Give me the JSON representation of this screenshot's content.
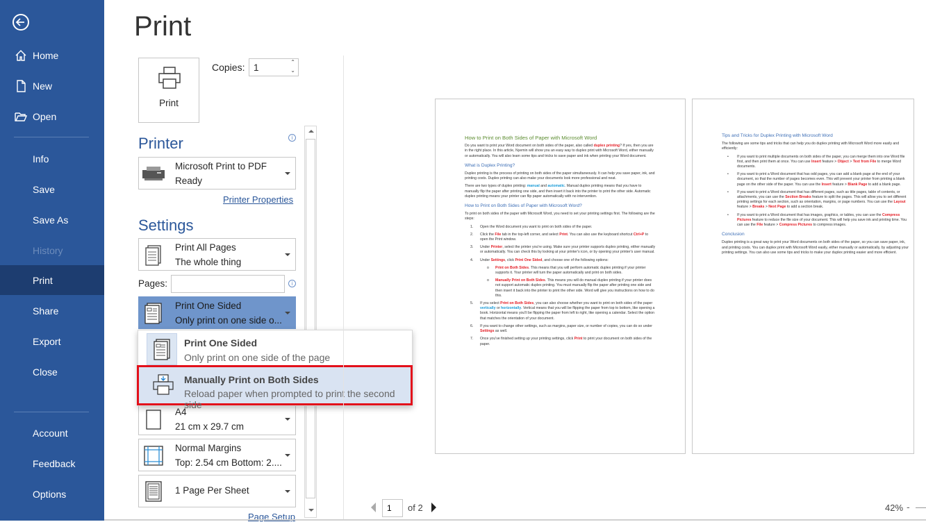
{
  "sidebar": {
    "back_label": "Back",
    "items": [
      {
        "label": "Home",
        "icon": "home-icon"
      },
      {
        "label": "New",
        "icon": "new-document-icon"
      },
      {
        "label": "Open",
        "icon": "folder-open-icon"
      },
      {
        "label": "Info"
      },
      {
        "label": "Save"
      },
      {
        "label": "Save As"
      },
      {
        "label": "History",
        "disabled": true
      },
      {
        "label": "Print",
        "selected": true
      },
      {
        "label": "Share"
      },
      {
        "label": "Export"
      },
      {
        "label": "Close"
      },
      {
        "label": "Account"
      },
      {
        "label": "Feedback"
      },
      {
        "label": "Options"
      }
    ],
    "color": "#2b579a"
  },
  "print": {
    "title": "Print",
    "print_button": "Print",
    "copies_label": "Copies:",
    "copies_value": "1",
    "printer_heading": "Printer",
    "printer": {
      "name": "Microsoft Print to PDF",
      "status": "Ready"
    },
    "printer_properties": "Printer Properties",
    "settings_heading": "Settings",
    "pages_range": {
      "title": "Print All Pages",
      "subtitle": "The whole thing"
    },
    "pages_label": "Pages:",
    "pages_value": "",
    "sides": {
      "title": "Print One Sided",
      "subtitle": "Only print on one side o..."
    },
    "sides_menu": [
      {
        "title": "Print One Sided",
        "subtitle": "Only print on one side of the page"
      },
      {
        "title": "Manually Print on Both Sides",
        "subtitle": "Reload paper when prompted to print the second side",
        "highlighted": true
      }
    ],
    "paper": {
      "title": "A4",
      "subtitle": "21 cm x 29.7 cm"
    },
    "margins": {
      "title": "Normal Margins",
      "subtitle": "Top: 2.54 cm Bottom: 2...."
    },
    "per_sheet": {
      "title": "1 Page Per Sheet"
    },
    "page_setup": "Page Setup",
    "info_icon": "i"
  },
  "preview": {
    "current_page": "1",
    "of_pages": "of 2",
    "zoom": "42%",
    "zoom_minus": "-"
  },
  "document": {
    "pages": [
      {
        "blocks": [
          {
            "type": "h1",
            "runs": [
              {
                "text": "How to Print on Both Sides of Paper with Microsoft Word"
              }
            ]
          },
          {
            "type": "p",
            "runs": [
              {
                "text": "Do you want to print your Word document on both sides of the paper, also called "
              },
              {
                "text": "duplex printing",
                "style": "red"
              },
              {
                "text": "? If yes, then you are in the right place. In this article, Nyemin will show you an easy way to duplex print with Microsoft Word, either manually or automatically. You will also learn some tips and tricks to save paper and ink when printing your Word document."
              }
            ]
          },
          {
            "type": "h2",
            "runs": [
              {
                "text": "What is Duplex Printing?"
              }
            ]
          },
          {
            "type": "p",
            "runs": [
              {
                "text": "Duplex printing is the process of printing on both sides of the paper simultaneously. It can help you save paper, ink, and printing costs. Duplex printing can also make your documents look more professional and neat."
              }
            ]
          },
          {
            "type": "p",
            "runs": [
              {
                "text": "There are two types of duplex printing: "
              },
              {
                "text": "manual",
                "style": "blue"
              },
              {
                "text": " and "
              },
              {
                "text": "automatic",
                "style": "blue"
              },
              {
                "text": ". Manual duplex printing means that you have to manually flip the paper after printing one side, and then insert it back into the printer to print the other side. Automatic duplex printing means your printer can flip paper automatically with no intervention."
              }
            ]
          },
          {
            "type": "h2",
            "runs": [
              {
                "text": "How to Print on Both Sides of Paper with Microsoft Word?"
              }
            ]
          },
          {
            "type": "p",
            "runs": [
              {
                "text": "To print on both sides of the paper with Microsoft Word, you need to set your printing settings first. The following are the steps:"
              }
            ]
          },
          {
            "type": "it",
            "marker": "1.",
            "runs": [
              {
                "text": "Open the Word document you want to print on both sides of the paper."
              }
            ]
          },
          {
            "type": "it",
            "marker": "2.",
            "runs": [
              {
                "text": "Click the "
              },
              {
                "text": "File",
                "style": "red"
              },
              {
                "text": " tab in the top-left corner, and select "
              },
              {
                "text": "Print",
                "style": "red"
              },
              {
                "text": ". You can also use the keyboard shortcut "
              },
              {
                "text": "Ctrl+P",
                "style": "red"
              },
              {
                "text": " to open the Print window."
              }
            ]
          },
          {
            "type": "it",
            "marker": "3.",
            "runs": [
              {
                "text": "Under "
              },
              {
                "text": "Printer",
                "style": "red"
              },
              {
                "text": ", select the printer you're using. Make sure your printer supports duplex printing, either manually or automatically. You can check this by looking at your printer's icon, or by opening your printer's user manual."
              }
            ]
          },
          {
            "type": "it",
            "marker": "4.",
            "runs": [
              {
                "text": "Under "
              },
              {
                "text": "Settings",
                "style": "red"
              },
              {
                "text": ", click "
              },
              {
                "text": "Print One Sided",
                "style": "red"
              },
              {
                "text": ", and choose one of the following options:"
              }
            ]
          },
          {
            "type": "sub",
            "marker": "o",
            "runs": [
              {
                "text": "Print on Both Sides",
                "style": "red"
              },
              {
                "text": ". This means that you will perform automatic duplex printing if your printer supports it. Your printer will turn the paper automatically and print on both sides."
              }
            ]
          },
          {
            "type": "sub",
            "marker": "o",
            "runs": [
              {
                "text": "Manually Print on Both Sides",
                "style": "red"
              },
              {
                "text": ". This means you will do manual duplex printing if your printer does not support automatic duplex printing. You must manually flip the paper after printing one side and then insert it back into the printer to print the other side. Word will give you instructions on how to do this."
              }
            ]
          },
          {
            "type": "it",
            "marker": "5.",
            "runs": [
              {
                "text": "If you select "
              },
              {
                "text": "Print on Both Sides",
                "style": "red"
              },
              {
                "text": ", you can also choose whether you want to print on both sides of the paper "
              },
              {
                "text": "vertically",
                "style": "blue"
              },
              {
                "text": " or "
              },
              {
                "text": "horizontally",
                "style": "blue"
              },
              {
                "text": ". Vertical means that you will be flipping the paper from top to bottom, like opening a book. Horizontal means you'll be flipping the paper from left to right, like opening a calendar. Select the option that matches the orientation of your document."
              }
            ]
          },
          {
            "type": "it",
            "marker": "6.",
            "runs": [
              {
                "text": "If you want to change other settings, such as margins, paper size, or number of copies, you can do so under "
              },
              {
                "text": "Settings",
                "style": "red"
              },
              {
                "text": " as well."
              }
            ]
          },
          {
            "type": "it",
            "marker": "7.",
            "runs": [
              {
                "text": "Once you've finished setting up your printing settings, click "
              },
              {
                "text": "Print",
                "style": "red"
              },
              {
                "text": " to print your document on both sides of the paper."
              }
            ]
          }
        ]
      },
      {
        "blocks": [
          {
            "type": "h2",
            "runs": [
              {
                "text": "Tips and Tricks for Duplex Printing with Microsoft Word"
              }
            ]
          },
          {
            "type": "p",
            "runs": [
              {
                "text": "The following are some tips and tricks that can help you do duplex printing with Microsoft Word more easily and efficiently:"
              }
            ]
          },
          {
            "type": "it",
            "marker": "•",
            "runs": [
              {
                "text": "If you want to print multiple documents on both sides of the paper, you can merge them into one Word file first, and then print them at once. You can use "
              },
              {
                "text": "Insert",
                "style": "red"
              },
              {
                "text": " feature > "
              },
              {
                "text": "Object",
                "style": "red"
              },
              {
                "text": " > "
              },
              {
                "text": "Text from File",
                "style": "red"
              },
              {
                "text": " to merge Word documents."
              }
            ]
          },
          {
            "type": "it",
            "marker": "•",
            "runs": [
              {
                "text": "If you want to print a Word document that has odd pages, you can add a blank page at the end of your document, so that the number of pages becomes even. This will prevent your printer from printing a blank page on the other side of the paper. You can use the "
              },
              {
                "text": "Insert",
                "style": "red"
              },
              {
                "text": " feature > "
              },
              {
                "text": "Blank Page",
                "style": "red"
              },
              {
                "text": " to add a blank page."
              }
            ]
          },
          {
            "type": "it",
            "marker": "•",
            "runs": [
              {
                "text": "If you want to print a Word document that has different pages, such as title pages, table of contents, or attachments, you can use the "
              },
              {
                "text": "Section Breaks",
                "style": "red"
              },
              {
                "text": " feature to split the pages. This will allow you to set different printing settings for each section, such as orientation, margins, or page numbers. You can use the "
              },
              {
                "text": "Layout",
                "style": "red"
              },
              {
                "text": " feature > "
              },
              {
                "text": "Breaks",
                "style": "red"
              },
              {
                "text": " > "
              },
              {
                "text": "Next Page",
                "style": "red"
              },
              {
                "text": " to add a section break."
              }
            ]
          },
          {
            "type": "it",
            "marker": "•",
            "runs": [
              {
                "text": "If you want to print a Word document that has images, graphics, or tables, you can use the "
              },
              {
                "text": "Compress Pictures",
                "style": "red"
              },
              {
                "text": " feature to reduce the file size of your document. This will help you save ink and printing time. You can use the "
              },
              {
                "text": "File",
                "style": "red"
              },
              {
                "text": " feature > "
              },
              {
                "text": "Compress Pictures",
                "style": "red"
              },
              {
                "text": " to compress images."
              }
            ]
          },
          {
            "type": "h2",
            "runs": [
              {
                "text": "Conclusion"
              }
            ]
          },
          {
            "type": "p",
            "runs": [
              {
                "text": "Duplex printing is a great way to print your Word documents on both sides of the paper, so you can save paper, ink, and printing costs. You can duplex print with Microsoft Word easily, either manually or automatically, by adjusting your printing settings. You can also use some tips and tricks to make your duplex printing easier and more efficient."
              }
            ]
          }
        ]
      }
    ]
  }
}
